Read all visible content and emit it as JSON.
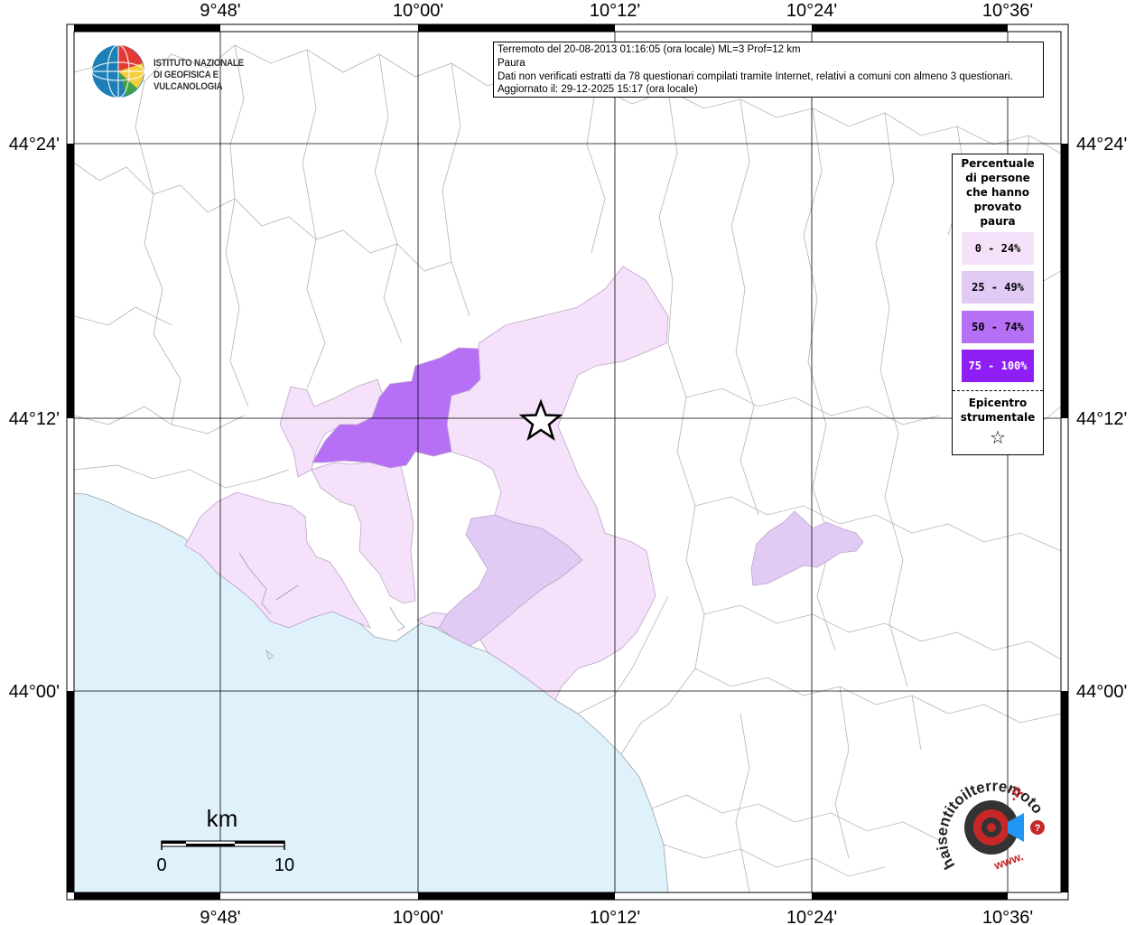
{
  "coord_labels": {
    "lon_top": [
      "9°48'",
      "10°00'",
      "10°12'",
      "10°24'",
      "10°36'"
    ],
    "lon_bottom": [
      "9°48'",
      "10°00'",
      "10°12'",
      "10°24'",
      "10°36'"
    ],
    "lat_left": [
      "44°24'",
      "44°12'",
      "44°00'"
    ],
    "lat_right": [
      "44°24'",
      "44°12'",
      "44°00'"
    ]
  },
  "info": {
    "line1": "Terremoto del 20-08-2013 01:16:05 (ora locale) ML=3 Prof=12 km",
    "line2": "Paura",
    "line3": "Dati non verificati estratti da 78 questionari compilati tramite Internet, relativi a comuni con almeno 3 questionari.",
    "line4": "Aggiornato il: 29-12-2025 15:17 (ora locale)"
  },
  "institute": {
    "line1": "ISTITUTO NAZIONALE",
    "line2": "DI GEOFISICA E VULCANOLOGIA"
  },
  "legend": {
    "title_lines": [
      "Percentuale",
      "di persone",
      "che hanno",
      "provato",
      "paura"
    ],
    "classes": [
      {
        "label": "0 - 24%",
        "color": "#f5e1f9",
        "text_color": "#000000"
      },
      {
        "label": "25 - 49%",
        "color": "#e1cbf5",
        "text_color": "#000000"
      },
      {
        "label": "50 - 74%",
        "color": "#b570f5",
        "text_color": "#000000"
      },
      {
        "label": "75 - 100%",
        "color": "#8f1ef5",
        "text_color": "#ffffff"
      }
    ],
    "epicenter_lines": [
      "Epicentro",
      "strumentale"
    ],
    "epicenter_symbol": "☆"
  },
  "scale_bar": {
    "unit": "km",
    "start": "0",
    "end": "10"
  },
  "colors": {
    "sea": "#dff1fb",
    "land": "#ffffff",
    "boundary": "#b4b4b4"
  },
  "hs_logo": {
    "text_main": "haisentitoilterremoto",
    "text_suffix": ".it",
    "text_prefix": "www."
  }
}
